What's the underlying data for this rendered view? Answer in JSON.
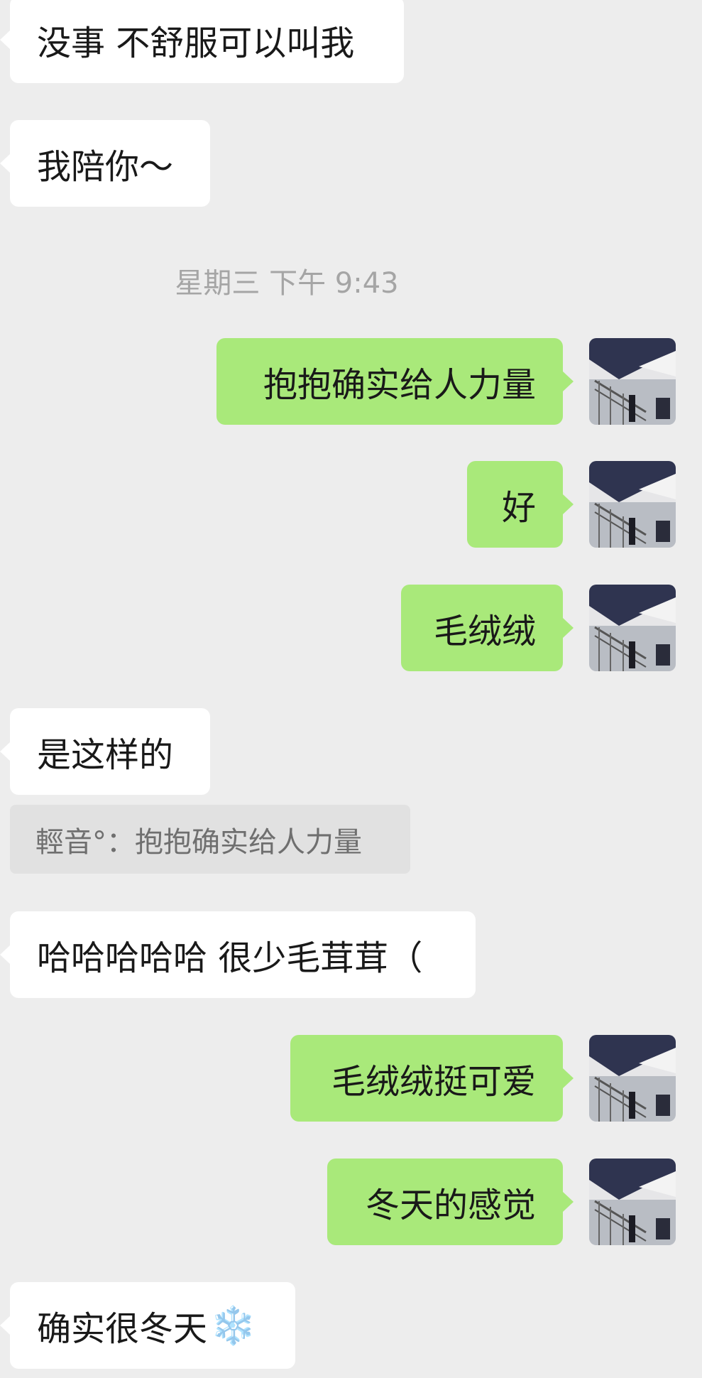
{
  "messages": {
    "m1": "没事 不舒服可以叫我",
    "m2": "我陪你～",
    "timestamp": "星期三 下午 9:43",
    "m3": "抱抱确实给人力量",
    "m4": "好",
    "m5": "毛绒绒",
    "m6": "是这样的",
    "quote": "輕音°：抱抱确实给人力量",
    "m7": "哈哈哈哈哈 很少毛茸茸（",
    "m8": "毛绒绒挺可爱",
    "m9": "冬天的感觉",
    "m10": "确实很冬天",
    "m10_emoji": "❄️"
  },
  "colors": {
    "background": "#ededed",
    "incoming_bubble": "#ffffff",
    "outgoing_bubble": "#a9e97a",
    "quote_background": "#e1e1e1",
    "timestamp_text": "#a5a5a5"
  },
  "icons": {
    "avatar": "user-avatar-photo",
    "snowflake": "snowflake-emoji"
  }
}
